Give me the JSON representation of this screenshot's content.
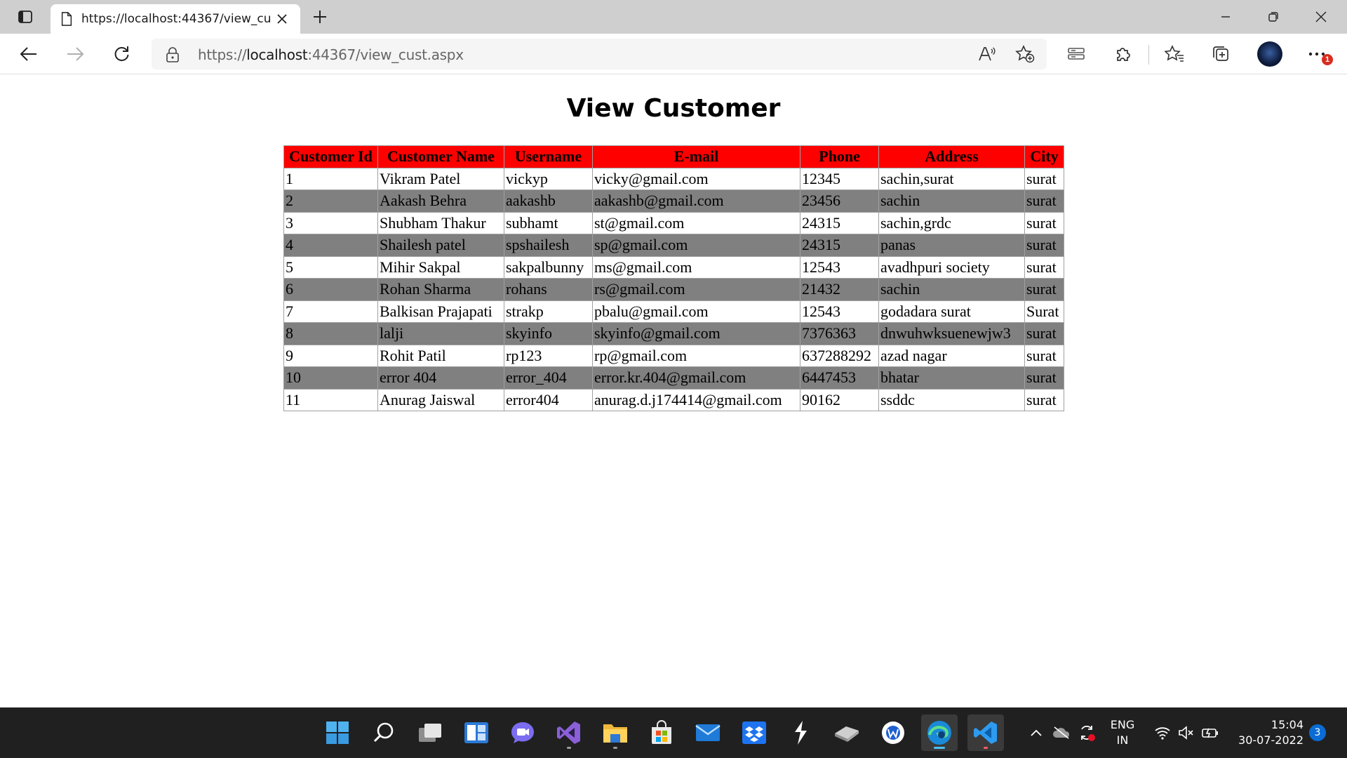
{
  "browser": {
    "tab_title": "https://localhost:44367/view_cust.aspx",
    "url_prefix": "https://",
    "url_host": "localhost",
    "url_rest": ":44367/view_cust.aspx",
    "notification_badge": "1"
  },
  "page": {
    "title": "View Customer"
  },
  "table": {
    "headers": [
      "Customer Id",
      "Customer Name",
      "Username",
      "E-mail",
      "Phone",
      "Address",
      "City"
    ],
    "rows": [
      [
        "1",
        "Vikram Patel",
        "vickyp",
        "vicky@gmail.com",
        "12345",
        "sachin,surat",
        "surat"
      ],
      [
        "2",
        "Aakash Behra",
        "aakashb",
        "aakashb@gmail.com",
        "23456",
        "sachin",
        "surat"
      ],
      [
        "3",
        "Shubham Thakur",
        "subhamt",
        "st@gmail.com",
        "24315",
        "sachin,grdc",
        "surat"
      ],
      [
        "4",
        "Shailesh patel",
        "spshailesh",
        "sp@gmail.com",
        "24315",
        "panas",
        "surat"
      ],
      [
        "5",
        "Mihir Sakpal",
        "sakpalbunny",
        "ms@gmail.com",
        "12543",
        "avadhpuri society",
        "surat"
      ],
      [
        "6",
        "Rohan Sharma",
        "rohans",
        "rs@gmail.com",
        "21432",
        "sachin",
        "surat"
      ],
      [
        "7",
        "Balkisan Prajapati",
        "strakp",
        "pbalu@gmail.com",
        "12543",
        "godadara surat",
        "Surat"
      ],
      [
        "8",
        "lalji",
        "skyinfo",
        "skyinfo@gmail.com",
        "7376363",
        "dnwuhwksuenewjw3",
        "surat"
      ],
      [
        "9",
        "Rohit Patil",
        "rp123",
        "rp@gmail.com",
        "637288292",
        "azad nagar",
        "surat"
      ],
      [
        "10",
        "error 404",
        "error_404",
        "error.kr.404@gmail.com",
        "6447453",
        "bhatar",
        "surat"
      ],
      [
        "11",
        "Anurag Jaiswal",
        "error404",
        "anurag.d.j174414@gmail.com",
        "90162",
        "ssddc",
        "surat"
      ]
    ],
    "header_color": "#ff0000",
    "alt_row_color": "#808080"
  },
  "taskbar": {
    "apps": [
      "start-icon",
      "search-icon",
      "task-view-icon",
      "widgets-icon",
      "chat-icon",
      "visual-studio-icon",
      "file-explorer-icon",
      "microsoft-store-icon",
      "mail-icon",
      "dropbox-icon",
      "sublime-icon",
      "drive-icon",
      "app-w-icon",
      "edge-icon",
      "vscode-icon"
    ],
    "lang_line1": "ENG",
    "lang_line2": "IN",
    "time": "15:04",
    "date": "30-07-2022",
    "notification_count": "3"
  }
}
